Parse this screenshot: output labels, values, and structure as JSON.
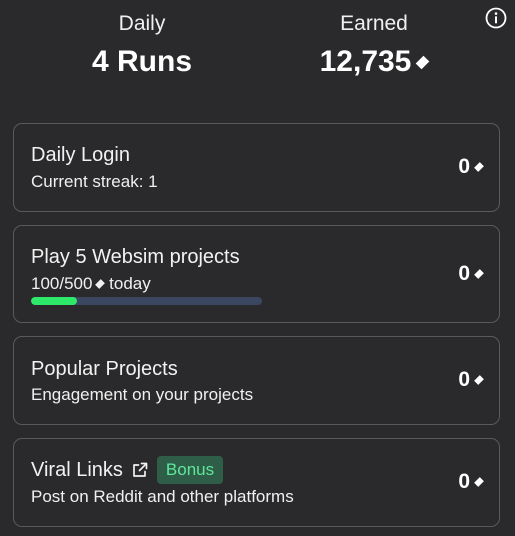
{
  "header": {
    "daily_label": "Daily",
    "daily_value": "4 Runs",
    "earned_label": "Earned",
    "earned_value": "12,735"
  },
  "cards": [
    {
      "title": "Daily Login",
      "subtitle": "Current streak: 1",
      "reward": "0"
    },
    {
      "title": "Play 5 Websim projects",
      "subtitle_prefix": "100/500",
      "subtitle_suffix": " today",
      "progress": 0.2,
      "reward": "0"
    },
    {
      "title": "Popular Projects",
      "subtitle": "Engagement on your projects",
      "reward": "0"
    },
    {
      "title": "Viral Links",
      "badge": "Bonus",
      "subtitle": "Post on Reddit and other platforms",
      "reward": "0"
    }
  ],
  "colors": {
    "background": "#2a2a2c",
    "card_border": "#5a5a5e",
    "progress_fill": "#2ee86a",
    "progress_track": "#3b4660",
    "bonus_bg": "#2f5e48",
    "bonus_text": "#5ee89a"
  },
  "icons": {
    "info": "info-icon",
    "external_link": "external-link-icon",
    "currency": "diamond-icon"
  }
}
